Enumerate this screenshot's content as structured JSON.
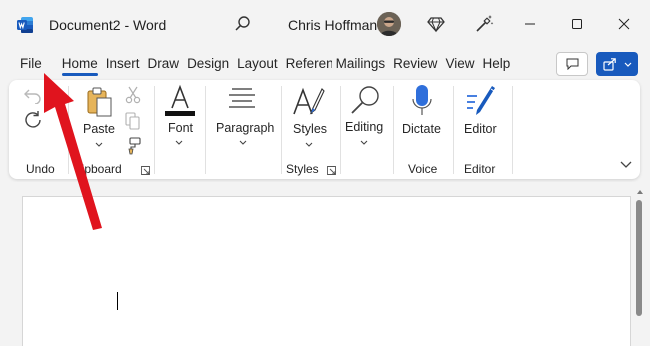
{
  "app": {
    "doc_title": "Document2  -  Word",
    "user_name": "Chris Hoffman"
  },
  "icons": [
    "word-logo-icon",
    "search-icon",
    "diamond-icon",
    "wand-icon",
    "minimize-icon",
    "maximize-icon",
    "close-icon",
    "comment-icon",
    "share-icon",
    "undo-icon",
    "redo-icon",
    "paste-icon",
    "cut-icon",
    "copy-icon",
    "format-painter-icon",
    "font-icon",
    "paragraph-icon",
    "styles-icon",
    "editing-icon",
    "dictate-icon",
    "editor-icon",
    "chevron-down-icon",
    "dialog-launcher-icon",
    "red-arrow-annotation"
  ],
  "colors": {
    "accent": "#185abd",
    "arrow": "#e0141e",
    "dictate": "#2f6fdb"
  },
  "tabs": [
    "File",
    "Home",
    "Insert",
    "Draw",
    "Design",
    "Layout",
    "Referenc",
    "Mailings",
    "Review",
    "View",
    "Help"
  ],
  "active_tab": "Home",
  "ribbon": {
    "undo_group": "Undo",
    "clipboard_group": "lipboard",
    "paste": "Paste",
    "font": "Font",
    "paragraph": "Paragraph",
    "styles": "Styles",
    "styles_group": "Styles",
    "editing": "Editing",
    "dictate": "Dictate",
    "voice_group": "Voice",
    "editor": "Editor",
    "editor_group": "Editor"
  }
}
